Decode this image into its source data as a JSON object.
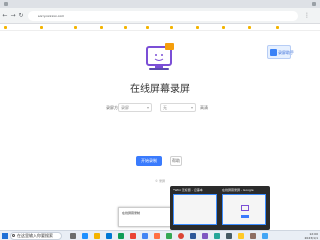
{
  "browser": {
    "address": "sorry.xxxxxx.com"
  },
  "page": {
    "title": "在线屏幕录屏",
    "side_badge": "录屏助手",
    "form": {
      "mode_label": "录屏方式",
      "mode_value": "录屏",
      "audio_label": "",
      "audio_value": "无",
      "quality_label": "高清"
    },
    "start_button": "开始录制",
    "help_button": "帮助",
    "note": "© 录屏"
  },
  "preview": {
    "thumb1_title": "*Wiki 无标题 - 记事本",
    "thumb2_title": "在线屏幕录屏 - Google"
  },
  "popup": {
    "text": "在线屏幕录制"
  },
  "taskbar": {
    "search_text": "在这里输入你要搜索",
    "time": "12:00",
    "date": "2023/1/1"
  },
  "colors": {
    "accent": "#3a7bfd",
    "hero_purple": "#7b4fd6",
    "hero_orange": "#f59e0b"
  }
}
